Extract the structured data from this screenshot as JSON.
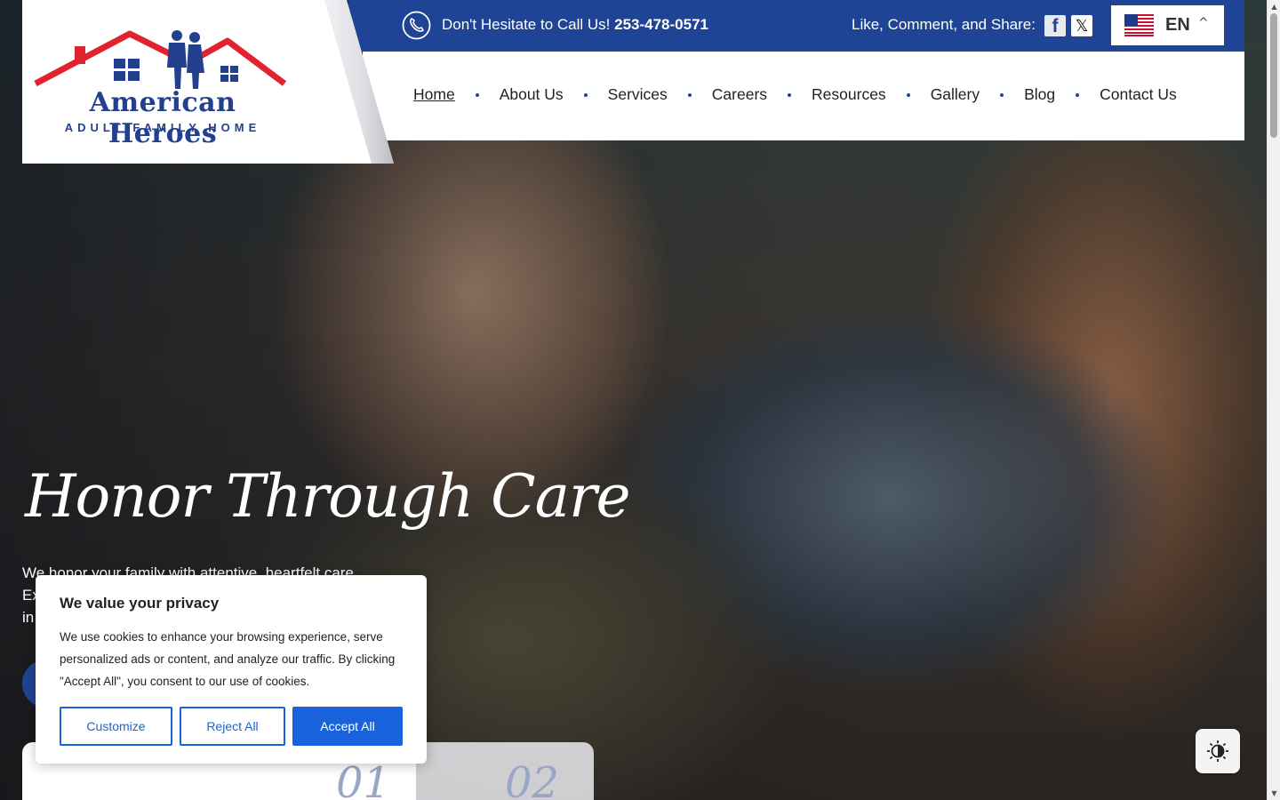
{
  "logo": {
    "title": "American Heroes",
    "subtitle": "ADULT FAMILY HOME"
  },
  "topbar": {
    "call_prefix": "Don't Hesitate to Call Us!",
    "phone": "253-478-0571",
    "share_label": "Like, Comment, and Share:",
    "facebook_glyph": "f",
    "x_glyph": "𝕏",
    "language": {
      "code": "EN",
      "caret": "^"
    }
  },
  "nav": {
    "items": [
      {
        "label": "Home"
      },
      {
        "label": "About Us"
      },
      {
        "label": "Services"
      },
      {
        "label": "Careers"
      },
      {
        "label": "Resources"
      },
      {
        "label": "Gallery"
      },
      {
        "label": "Blog"
      },
      {
        "label": "Contact Us"
      }
    ]
  },
  "hero": {
    "title": "Honor Through Care",
    "description_line1": "We honor your family with attentive, heartfelt care.",
    "description_line2": "Ex",
    "description_line3": "in"
  },
  "cards": {
    "num1": "01",
    "num2": "02"
  },
  "cookie": {
    "title": "We value your privacy",
    "body": "We use cookies to enhance your browsing experience, serve personalized ads or content, and analyze our traffic. By clicking \"Accept All\", you consent to our use of cookies.",
    "customize": "Customize",
    "reject": "Reject All",
    "accept": "Accept All"
  },
  "colors": {
    "brand_blue": "#1f4496",
    "brand_red": "#e0232e",
    "cookie_accent": "#1863dc"
  },
  "icons": {
    "phone": "phone-icon",
    "facebook": "facebook-icon",
    "x": "x-icon",
    "flag": "us-flag-icon",
    "contrast": "contrast-icon"
  }
}
